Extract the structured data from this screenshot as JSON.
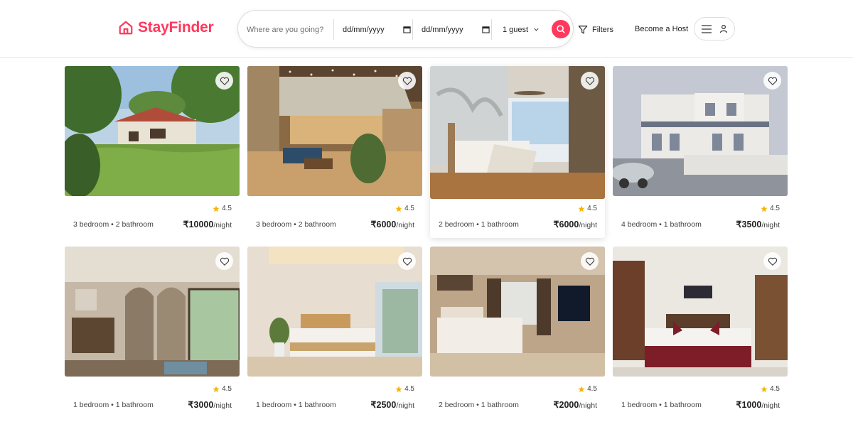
{
  "brand": {
    "name": "StayFinder",
    "color": "#ff385c",
    "logo_icon": "house-icon"
  },
  "search": {
    "where_placeholder": "Where are you going?",
    "checkin_value": "dd/mm/yyyy",
    "checkout_value": "dd/mm/yyyy",
    "guests_value": "1 guest",
    "search_icon": "search-icon"
  },
  "nav": {
    "filters_label": "Filters",
    "become_host_label": "Become a Host",
    "menu_icon": "hamburger-icon",
    "user_icon": "user-icon"
  },
  "listings": [
    {
      "rating": "4.5",
      "specs": "3 bedroom • 2 bathroom",
      "price": "₹10000",
      "unit": "/night",
      "photo": "garden cottage"
    },
    {
      "rating": "4.5",
      "specs": "3 bedroom • 2 bathroom",
      "price": "₹6000",
      "unit": "/night",
      "photo": "lit terrace lounge"
    },
    {
      "rating": "4.5",
      "specs": "2 bedroom • 1 bathroom",
      "price": "₹6000",
      "unit": "/night",
      "photo": "bedroom with balcony"
    },
    {
      "rating": "4.5",
      "specs": "4 bedroom • 1 bathroom",
      "price": "₹3500",
      "unit": "/night",
      "photo": "white two-storey house"
    },
    {
      "rating": "4.5",
      "specs": "1 bedroom • 1 bathroom",
      "price": "₹3000",
      "unit": "/night",
      "photo": "arched room with desk"
    },
    {
      "rating": "4.5",
      "specs": "1 bedroom • 1 bathroom",
      "price": "₹2500",
      "unit": "/night",
      "photo": "bright bedroom"
    },
    {
      "rating": "4.5",
      "specs": "2 bedroom • 1 bathroom",
      "price": "₹2000",
      "unit": "/night",
      "photo": "bedroom with tv"
    },
    {
      "rating": "4.5",
      "specs": "1 bedroom • 1 bathroom",
      "price": "₹1000",
      "unit": "/night",
      "photo": "maroon bedroom"
    }
  ],
  "colors": {
    "accent": "#ff385c",
    "star": "#f7b500"
  }
}
